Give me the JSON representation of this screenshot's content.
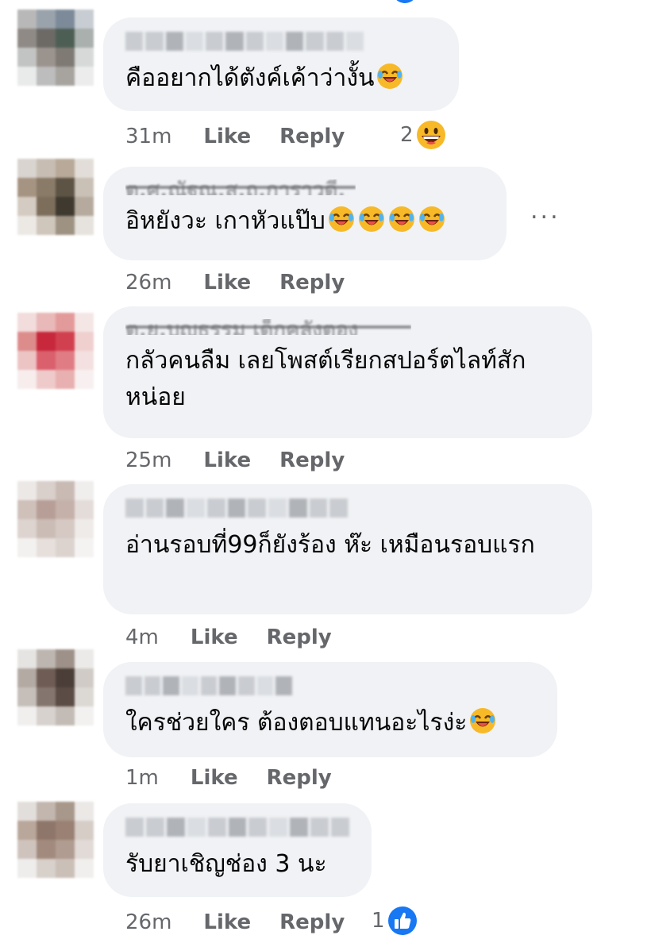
{
  "comments": [
    {
      "text": "คืออยากได้ตังค์เค้าว่างั้น",
      "emoji_count": 1,
      "time": "31m",
      "like": "Like",
      "reply": "Reply",
      "reaction_count": "2",
      "reaction_icon": "grinning-face-icon",
      "avatar_colors": [
        "#b8b8b8",
        "#9aa3ab",
        "#7d8a9a",
        "#c7cdd3",
        "#8f8a86",
        "#6d6a66",
        "#4d5f55",
        "#a9b0ad",
        "#c2c4c3",
        "#9b948e",
        "#7f7a74",
        "#d6d9d8",
        "#e9eaea",
        "#bdbdbd",
        "#a7a39f",
        "#ececec"
      ]
    },
    {
      "name_garbled": "ต.ศ.ณัฐณ.ส.ถ.การาวดี.",
      "text": "อิหยังวะ เกาหัวแป๊บ",
      "emoji_count": 4,
      "time": "26m",
      "like": "Like",
      "reply": "Reply",
      "menu_label": "...",
      "avatar_colors": [
        "#d9d4cf",
        "#c7bdb2",
        "#b8a998",
        "#e2ddd8",
        "#a69482",
        "#8a7a68",
        "#5e5446",
        "#c9c0b6",
        "#d4cbc2",
        "#7d6e5c",
        "#3f392f",
        "#b5aa9d",
        "#ece9e5",
        "#cfc6bc",
        "#9e9283",
        "#e6e2dd"
      ]
    },
    {
      "name_garbled": "ต.ย.บุญธรรม เด็กคลังตอง",
      "text": "กลัวคนลืม เลยโพสต์เรียกสปอร์ตไลท์สักหน่อย",
      "time": "25m",
      "like": "Like",
      "reply": "Reply",
      "avatar_colors": [
        "#f2dcdc",
        "#e9b8b8",
        "#e39a9a",
        "#f5e6e6",
        "#dd8c8c",
        "#c8283b",
        "#d1404f",
        "#f0cfcf",
        "#ecc4c4",
        "#d9606c",
        "#e07c84",
        "#f4e0e0",
        "#f7eded",
        "#eecaca",
        "#e8b0b0",
        "#f8f0f0"
      ]
    },
    {
      "text": "อ่านรอบที่99ก็ยังร้อง ห๊ะ เหมือนรอบแรก",
      "time": "4m",
      "like": "Like",
      "reply": "Reply",
      "avatar_colors": [
        "#ece8e6",
        "#d9cfcb",
        "#c9bab4",
        "#f0eded",
        "#cfc0ba",
        "#b79f97",
        "#c5b1aa",
        "#e4dcd9",
        "#ddd3cf",
        "#cbbcb6",
        "#d6c9c4",
        "#efebe9",
        "#f3f1f0",
        "#e6dfdc",
        "#dcd3cf",
        "#f5f3f2"
      ]
    },
    {
      "text": "ใครช่วยใคร ต้องตอบแทนอะไรง่ะ",
      "emoji_count": 1,
      "time": "1m",
      "like": "Like",
      "reply": "Reply",
      "avatar_colors": [
        "#e6e4e2",
        "#bdb6b0",
        "#9e918a",
        "#eceae8",
        "#b2aaa3",
        "#6f5d55",
        "#4b3e38",
        "#d0cbc7",
        "#c6bfb9",
        "#84766f",
        "#5b4c45",
        "#dcd8d4",
        "#f0efee",
        "#d7d2ce",
        "#c3bbb5",
        "#f2f1f0"
      ]
    },
    {
      "text": "รับยาเชิญช่อง 3 นะ",
      "time": "26m",
      "like": "Like",
      "reply": "Reply",
      "reaction_count": "1",
      "reaction_icon": "thumbs-up-icon",
      "avatar_colors": [
        "#e2dedb",
        "#c2b6ae",
        "#a8978b",
        "#ebe8e6",
        "#b9a79b",
        "#8f766a",
        "#9a8174",
        "#d6cdc7",
        "#cfc4bd",
        "#a28b7e",
        "#b09c90",
        "#e1dad6",
        "#efedeb",
        "#d8d0ca",
        "#cbc0b8",
        "#f1efed"
      ]
    }
  ]
}
